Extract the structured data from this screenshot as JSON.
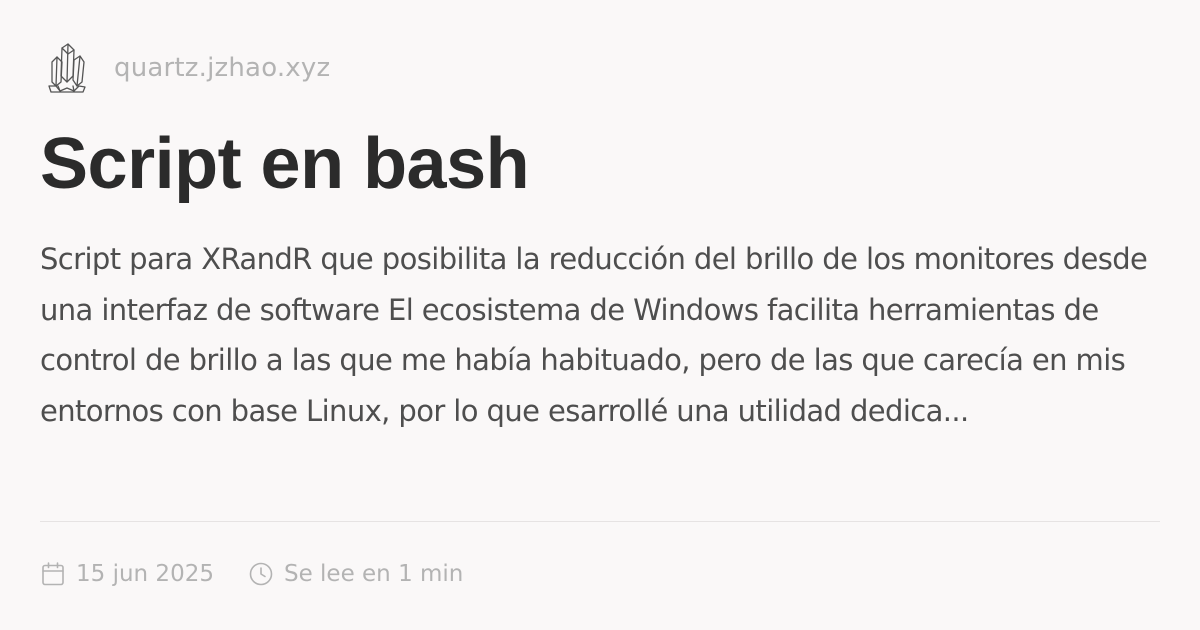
{
  "site": {
    "logo_icon": "crystal-cluster-icon",
    "domain": "quartz.jzhao.xyz"
  },
  "page": {
    "title": "Script en bash",
    "excerpt": "Script para XRandR que posibilita la reducción del brillo de los monitores desde una interfaz de software El ecosistema de Windows facilita herramientas de control de brillo a las que me había habituado, pero de las que carecía en mis entornos con base Linux, por lo que esarrollé una utilidad dedica..."
  },
  "meta": {
    "date_icon": "calendar-icon",
    "date": "15 jun 2025",
    "reading_time_icon": "clock-icon",
    "reading_time": "Se lee en 1 min"
  },
  "colors": {
    "background": "#faf8f8",
    "title": "#2b2b2b",
    "body_text": "#4e4e4e",
    "muted": "#b3b3b3"
  }
}
